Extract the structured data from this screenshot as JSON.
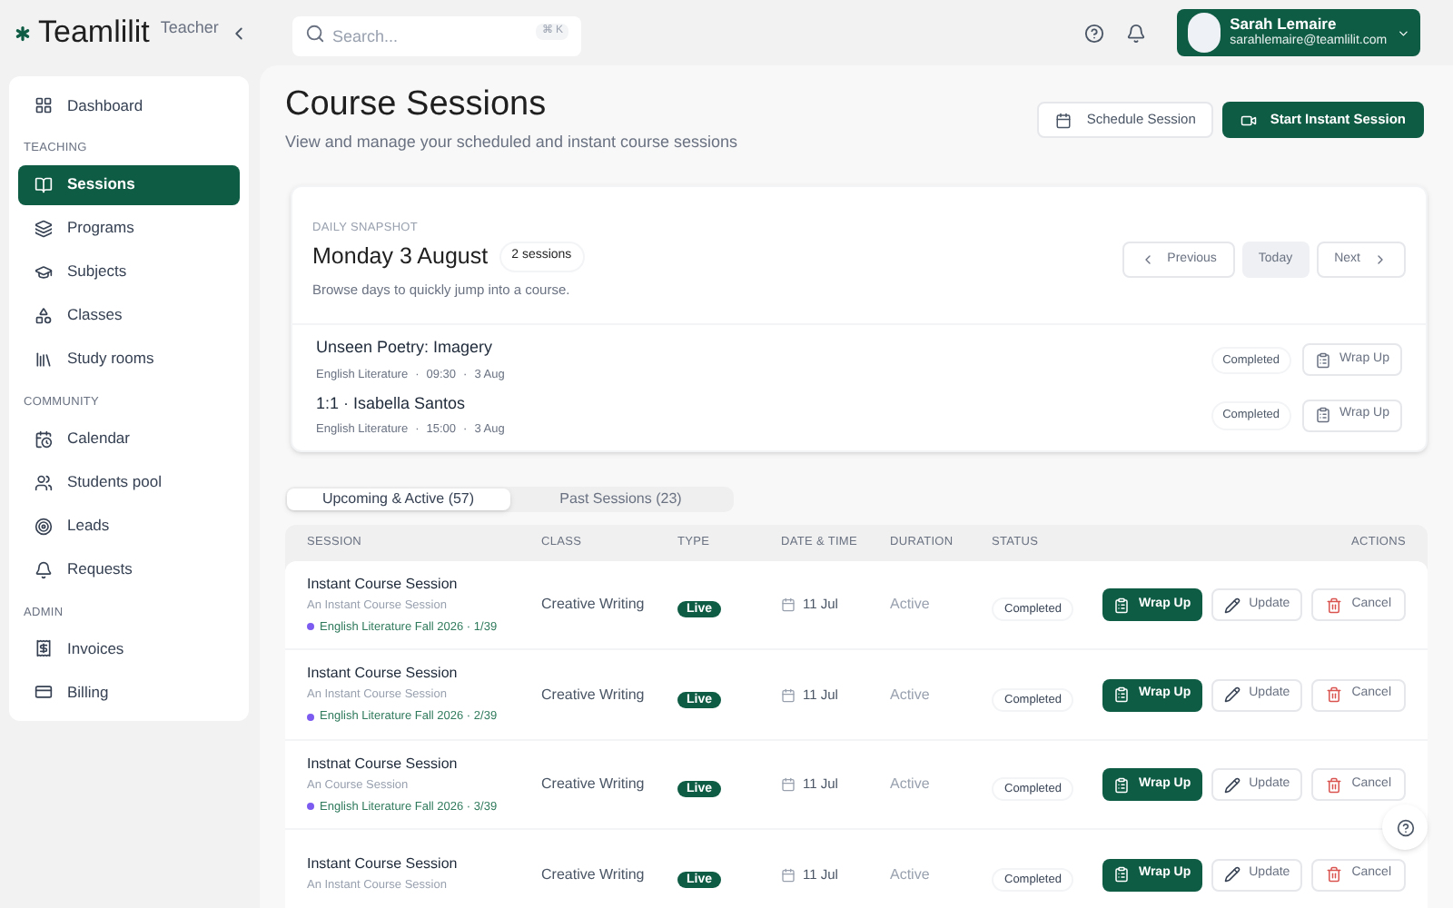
{
  "brand": {
    "name": "Teamlilit",
    "role": "Teacher"
  },
  "search": {
    "placeholder": "Search...",
    "shortcut": "⌘ K"
  },
  "user": {
    "name": "Sarah Lemaire",
    "email": "sarahlemaire@teamlilit.com"
  },
  "sidebar": {
    "items": [
      {
        "kind": "item",
        "label": "Dashboard",
        "selected": false
      },
      {
        "kind": "section",
        "label": "TEACHING"
      },
      {
        "kind": "item",
        "label": "Sessions",
        "selected": true
      },
      {
        "kind": "item",
        "label": "Programs",
        "selected": false
      },
      {
        "kind": "item",
        "label": "Subjects",
        "selected": false
      },
      {
        "kind": "item",
        "label": "Classes",
        "selected": false
      },
      {
        "kind": "item",
        "label": "Study rooms",
        "selected": false
      },
      {
        "kind": "section",
        "label": "COMMUNITY"
      },
      {
        "kind": "item",
        "label": "Calendar",
        "selected": false
      },
      {
        "kind": "item",
        "label": "Students pool",
        "selected": false
      },
      {
        "kind": "item",
        "label": "Leads",
        "selected": false
      },
      {
        "kind": "item",
        "label": "Requests",
        "selected": false
      },
      {
        "kind": "section",
        "label": "ADMIN"
      },
      {
        "kind": "item",
        "label": "Invoices",
        "selected": false
      },
      {
        "kind": "item",
        "label": "Billing",
        "selected": false
      }
    ]
  },
  "page": {
    "title": "Course Sessions",
    "subtitle": "View and manage your scheduled and instant course sessions",
    "buttons": [
      {
        "label": "Schedule Session",
        "kind": "secondary"
      },
      {
        "label": "Start Instant Session",
        "kind": "primary"
      }
    ]
  },
  "snapshot": {
    "eyebrow": "DAILY SNAPSHOT",
    "date": "Monday 3 August",
    "count": "2 sessions",
    "hint": "Browse days to quickly jump into a course.",
    "nav": [
      "Previous",
      "Today",
      "Next"
    ],
    "sessions": [
      {
        "title": "Unseen Poetry: Imagery",
        "meta": [
          "English Literature",
          "·",
          "09:30",
          "·",
          "3 Aug"
        ],
        "status": "Completed",
        "action": "Wrap Up"
      },
      {
        "title": "1:1 · Isabella Santos",
        "meta": [
          "English Literature",
          "·",
          "15:00",
          "·",
          "3 Aug"
        ],
        "status": "Completed",
        "action": "Wrap Up"
      }
    ]
  },
  "tabs": [
    {
      "label": "Upcoming & Active (57)",
      "selected": true
    },
    {
      "label": "Past Sessions (23)",
      "selected": false
    }
  ],
  "table": {
    "columns": [
      "SESSION",
      "CLASS",
      "TYPE",
      "DATE & TIME",
      "DURATION",
      "STATUS",
      "ACTIONS"
    ],
    "rows": [
      {
        "title": "Instant Course Session",
        "subtitle": "An Instant Course Session",
        "program": "English Literature Fall 2026 · 1/39",
        "color": "#7c5cf0",
        "class": "Creative Writing",
        "type": "Live",
        "date": "11 Jul",
        "duration": "Active",
        "status": "Completed",
        "actions": [
          "Wrap Up",
          "Update",
          "Cancel"
        ]
      },
      {
        "title": "Instant Course Session",
        "subtitle": "An Instant Course Session",
        "program": "English Literature Fall 2026 · 2/39",
        "color": "#7c5cf0",
        "class": "Creative Writing",
        "type": "Live",
        "date": "11 Jul",
        "duration": "Active",
        "status": "Completed",
        "actions": [
          "Wrap Up",
          "Update",
          "Cancel"
        ]
      },
      {
        "title": "Instnat Course Session",
        "subtitle": "An Course Session",
        "program": "English Literature Fall 2026 · 3/39",
        "color": "#7c5cf0",
        "class": "Creative Writing",
        "type": "Live",
        "date": "11 Jul",
        "duration": "Active",
        "status": "Completed",
        "actions": [
          "Wrap Up",
          "Update",
          "Cancel"
        ]
      },
      {
        "title": "Instant Course Session",
        "subtitle": "An Instant Course Session",
        "class": "Creative Writing",
        "type": "Live",
        "date": "11 Jul",
        "duration": "Active",
        "status": "Completed",
        "actions": [
          "Wrap Up",
          "Update",
          "Cancel"
        ]
      }
    ]
  }
}
